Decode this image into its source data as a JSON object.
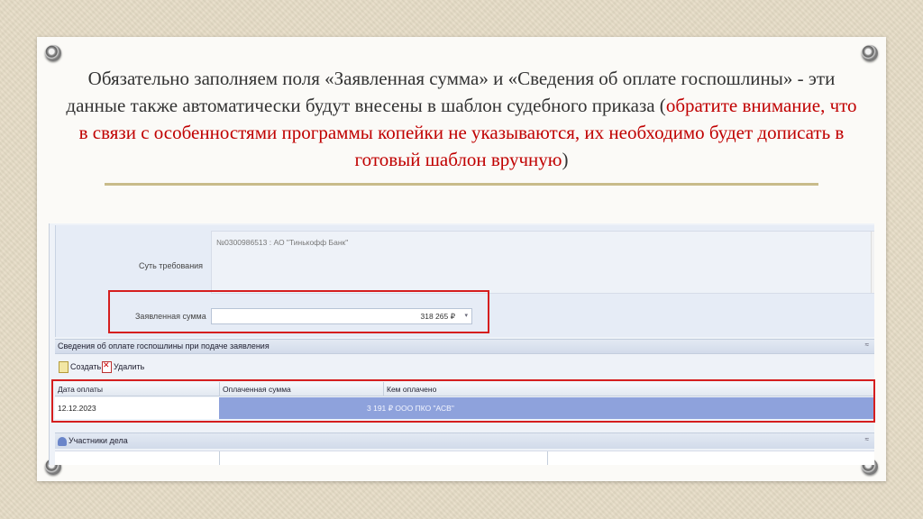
{
  "slide": {
    "heading_part1": "Обязательно заполняем поля «Заявленная сумма» и «Сведения об оплате госпошлины» - эти данные также автоматически будут внесены в шаблон судебного приказа (",
    "heading_red": "обратите внимание, что в связи с особенностями программы копейки не указываются, их необходимо будет дописать в готовый шаблон вручную",
    "heading_part2": ")"
  },
  "form": {
    "claim_label": "Суть требования",
    "claim_text": "№0300986513 : АО \"Тинькофф Банк\"",
    "amount_label": "Заявленная сумма",
    "amount_value": "318 265 ₽",
    "dropdown_arrow": "▾"
  },
  "fee_section": {
    "title": "Сведения об оплате госпошлины при подаче заявления",
    "collapse_icon": "≈",
    "create_label": "Создать",
    "delete_label": "Удалить",
    "columns": [
      "Дата оплаты",
      "Оплаченная сумма",
      "Кем оплачено"
    ],
    "row": {
      "date": "12.12.2023",
      "merged_text": "3 191 ₽ ООО ПКО \"АСВ\""
    }
  },
  "participants": {
    "title": "Участники дела",
    "collapse_icon": "≈"
  },
  "colors": {
    "highlight": "#d51e1e",
    "red_text": "#c00000",
    "selected_row": "#8ea2dc"
  }
}
